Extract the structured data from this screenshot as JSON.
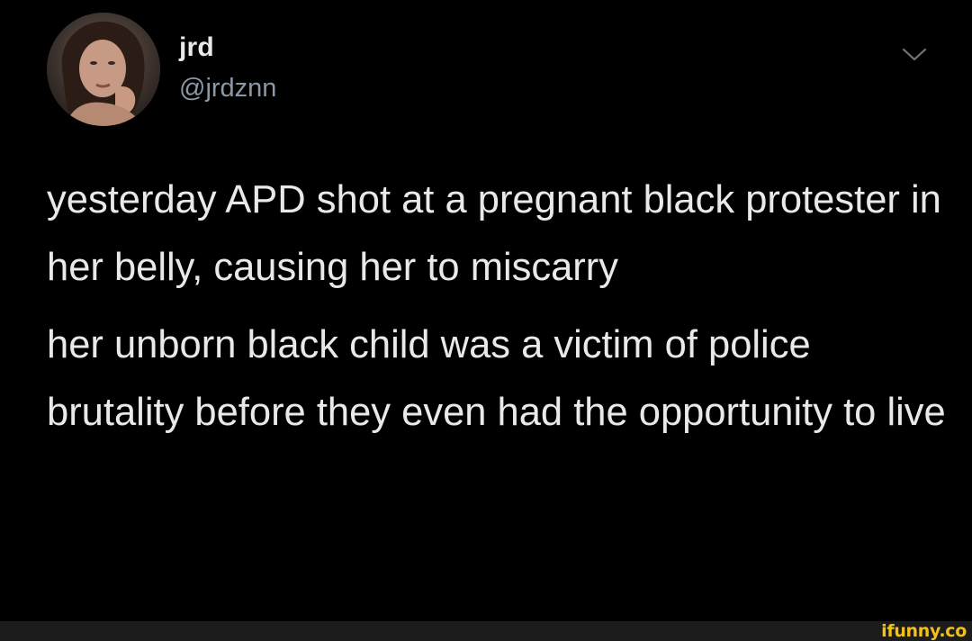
{
  "tweet": {
    "author": {
      "display_name": "jrd",
      "handle": "@jrdznn",
      "avatar_icon": "profile-photo"
    },
    "menu_icon": "chevron-down-icon",
    "paragraphs": [
      "yesterday APD shot at a pregnant black protester in her belly, causing her to miscarry",
      "her unborn black child was a victim of police brutality before they even had the opportunity to live"
    ]
  },
  "watermark": {
    "text": "ifunny.co",
    "color": "#f2c018"
  },
  "colors": {
    "background": "#000000",
    "text_primary": "#e7e9ea",
    "text_secondary": "#8b98a5",
    "footer_bar": "#1c1c1c"
  }
}
